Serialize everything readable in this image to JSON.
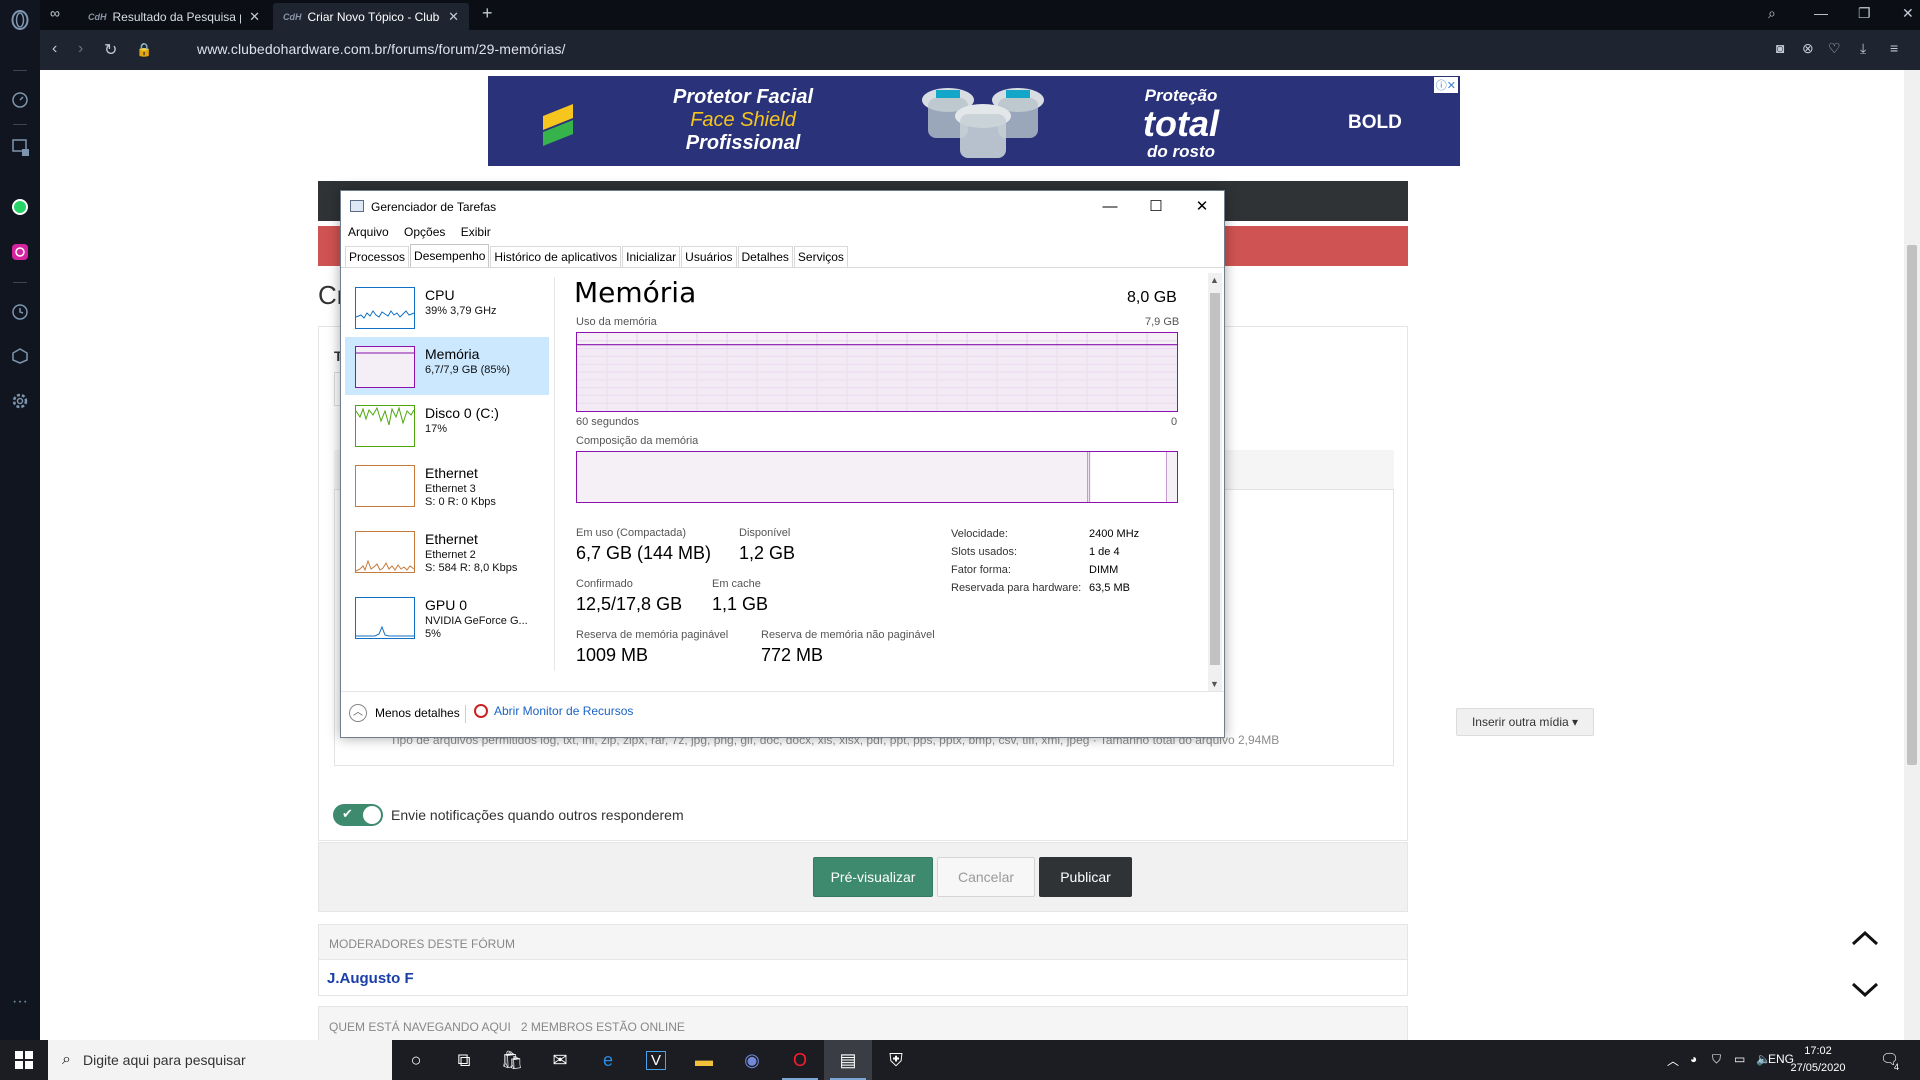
{
  "browser": {
    "tabs": [
      {
        "label": "Resultado da Pesquisa por"
      },
      {
        "label": "Criar Novo Tópico - Clube"
      }
    ],
    "url": "www.clubedohardware.com.br/forums/forum/29-memórias/"
  },
  "ad": {
    "line1": "Protetor Facial",
    "line2": "Face Shield",
    "line3": "Profissional",
    "right1": "Proteção",
    "right2": "total",
    "right3": "do rosto",
    "brand": "BOLD"
  },
  "page": {
    "title_fragment": "Cr",
    "field_fragment": "T",
    "allowed_types": "Tipo de arquivos permitidos log, txt, ini, zip, zipx, rar, 7z, jpg, png, gif, doc, docx, xls, xlsx, pdf, ppt, pps, pptx, bmp, csv, tiff, xml, jpeg · Tamanho total do arquivo 2,94MB",
    "insert_media": "Inserir outra mídia",
    "notify_text": "Envie notificações quando outros responderem",
    "preview_label": "Pré-visualizar",
    "cancel_label": "Cancelar",
    "publish_label": "Publicar",
    "moderators_heading": "MODERADORES DESTE FÓRUM",
    "moderator_name": "J.Augusto F",
    "online_heading": "QUEM ESTÁ NAVEGANDO AQUI",
    "online_count": "2 MEMBROS ESTÃO ONLINE"
  },
  "taskmgr": {
    "title": "Gerenciador de Tarefas",
    "menu": [
      "Arquivo",
      "Opções",
      "Exibir"
    ],
    "tabs": [
      "Processos",
      "Desempenho",
      "Histórico de aplicativos",
      "Inicializar",
      "Usuários",
      "Detalhes",
      "Serviços"
    ],
    "selected_tab": "Desempenho",
    "items": [
      {
        "name": "CPU",
        "sub": "39%  3,79 GHz",
        "sub2": ""
      },
      {
        "name": "Memória",
        "sub": "6,7/7,9 GB (85%)",
        "sub2": ""
      },
      {
        "name": "Disco 0 (C:)",
        "sub": "17%",
        "sub2": ""
      },
      {
        "name": "Ethernet",
        "sub": "Ethernet 3",
        "sub2": "S: 0  R: 0 Kbps"
      },
      {
        "name": "Ethernet",
        "sub": "Ethernet 2",
        "sub2": "S: 584  R: 8,0 Kbps"
      },
      {
        "name": "GPU 0",
        "sub": "NVIDIA GeForce G...",
        "sub2": "5%"
      }
    ],
    "panel": {
      "title": "Memória",
      "total": "8,0 GB",
      "usage_label": "Uso da memória",
      "usage_max": "7,9 GB",
      "time_label": "60 segundos",
      "time_zero": "0",
      "usage_fraction": 0.85,
      "composition_label": "Composição da memória",
      "in_use_label": "Em uso (Compactada)",
      "in_use_value": "6,7 GB (144 MB)",
      "available_label": "Disponível",
      "available_value": "1,2 GB",
      "committed_label": "Confirmado",
      "committed_value": "12,5/17,8 GB",
      "cached_label": "Em cache",
      "cached_value": "1,1 GB",
      "paged_label": "Reserva de memória paginável",
      "paged_value": "1009 MB",
      "nonpaged_label": "Reserva de memória não paginável",
      "nonpaged_value": "772 MB",
      "specs": [
        {
          "k": "Velocidade:",
          "v": "2400 MHz"
        },
        {
          "k": "Slots usados:",
          "v": "1 de 4"
        },
        {
          "k": "Fator forma:",
          "v": "DIMM"
        },
        {
          "k": "Reservada para hardware:",
          "v": "63,5 MB"
        }
      ]
    },
    "less_details": "Menos detalhes",
    "open_resource_monitor": "Abrir Monitor de Recursos"
  },
  "taskbar": {
    "search_placeholder": "Digite aqui para pesquisar",
    "lang": "ENG",
    "time": "17:02",
    "date": "27/05/2020",
    "notification_count": "4"
  },
  "colors": {
    "memory_purple": "#8b12ae",
    "cpu_blue": "#1170c4",
    "disk_green": "#4da60c",
    "ethernet_orange": "#c77a3a",
    "forum_red": "#cf5352",
    "forum_green": "#3e8a6e"
  }
}
